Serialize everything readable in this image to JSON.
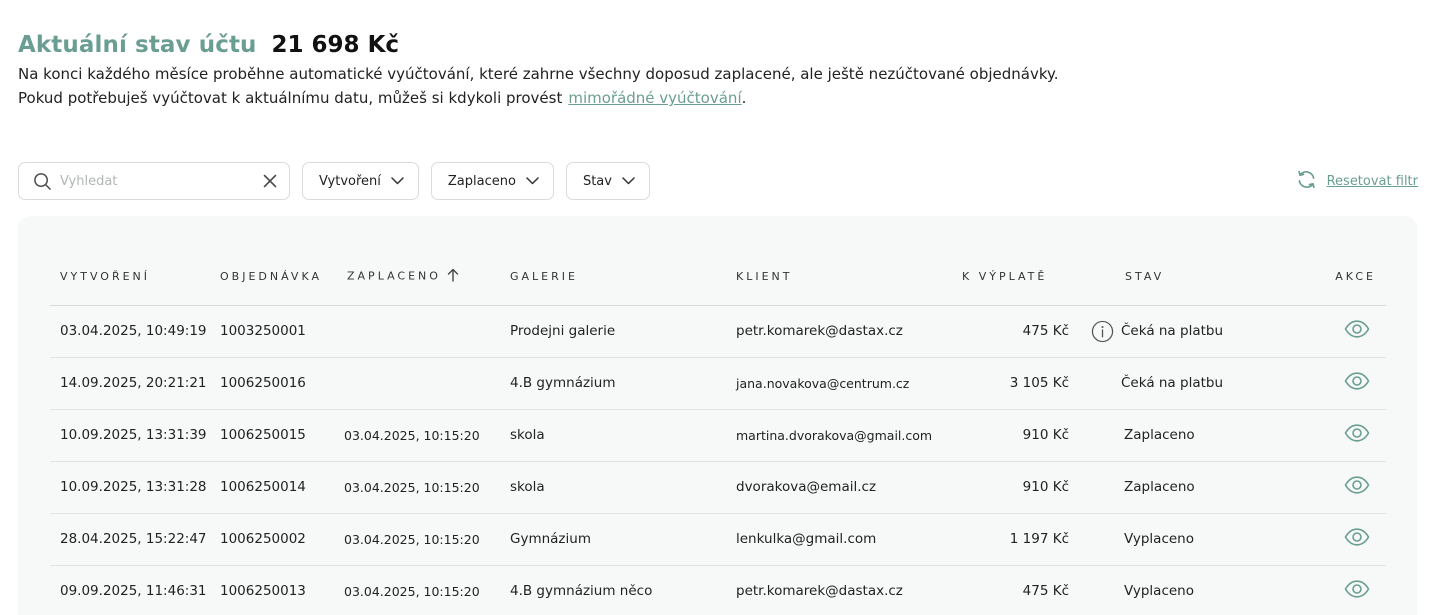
{
  "header": {
    "title": "Aktuální stav účtu",
    "balance": "21 698 Kč",
    "desc_line1": "Na konci každého měsíce proběhne automatické vyúčtování, které zahrne všechny doposud zaplacené, ale ještě nezúčtované objednávky.",
    "desc_line2": "Pokud potřebuješ vyúčtovat k aktuálnímu datu, můžeš si kdykoli provést",
    "desc_link": "mimořádné vyúčtování",
    "desc_end": "."
  },
  "filters": {
    "search_placeholder": "Vyhledat",
    "search_value": "",
    "created_label": "Vytvoření",
    "paid_label": "Zaplaceno",
    "status_label": "Stav",
    "reset_label": "Resetovat filtr"
  },
  "table": {
    "columns": {
      "created": "VYTVOŘENÍ",
      "order": "OBJEDNÁVKA",
      "paid": "ZAPLACENO",
      "gallery": "GALERIE",
      "client": "KLIENT",
      "payout": "K VÝPLATĚ",
      "status": "STAV",
      "actions": "AKCE"
    },
    "rows": [
      {
        "created": "03.04.2025, 10:49:19",
        "order": "1003250001",
        "paid": "",
        "gallery": "Prodejni galerie",
        "client": "petr.komarek@dastax.cz",
        "payout": "475 Kč",
        "status": "Čeká na platbu",
        "info": true
      },
      {
        "created": "14.09.2025, 20:21:21",
        "order": "1006250016",
        "paid": "",
        "gallery": "4.B gymnázium",
        "client": "jana.novakova@centrum.cz",
        "payout": "3 105 Kč",
        "status": "Čeká na platbu",
        "info": false
      },
      {
        "created": "10.09.2025, 13:31:39",
        "order": "1006250015",
        "paid": "03.04.2025, 10:15:20",
        "gallery": "skola",
        "client": "martina.dvorakova@gmail.com",
        "payout": "910 Kč",
        "status": "Zaplaceno",
        "info": false
      },
      {
        "created": "10.09.2025, 13:31:28",
        "order": "1006250014",
        "paid": "03.04.2025, 10:15:20",
        "gallery": "skola",
        "client": "dvorakova@email.cz",
        "payout": "910 Kč",
        "status": "Zaplaceno",
        "info": false
      },
      {
        "created": "28.04.2025, 15:22:47",
        "order": "1006250002",
        "paid": "03.04.2025, 10:15:20",
        "gallery": "Gymnázium",
        "client": "lenkulka@gmail.com",
        "payout": "1 197 Kč",
        "status": "Vyplaceno",
        "info": false
      },
      {
        "created": "09.09.2025, 11:46:31",
        "order": "1006250013",
        "paid": "03.04.2025, 10:15:20",
        "gallery": "4.B gymnázium něco",
        "client": "petr.komarek@dastax.cz",
        "payout": "475 Kč",
        "status": "Vyplaceno",
        "info": false
      }
    ]
  },
  "colors": {
    "accent": "#6a9e92",
    "panel_bg": "#f7f9f8",
    "border": "#d9dcdb"
  },
  "icons": {
    "search": "search-icon",
    "clear": "close-icon",
    "chevron": "chevron-down-icon",
    "reset": "refresh-icon",
    "sort": "arrow-up-icon",
    "info": "info-icon",
    "view": "eye-icon"
  }
}
